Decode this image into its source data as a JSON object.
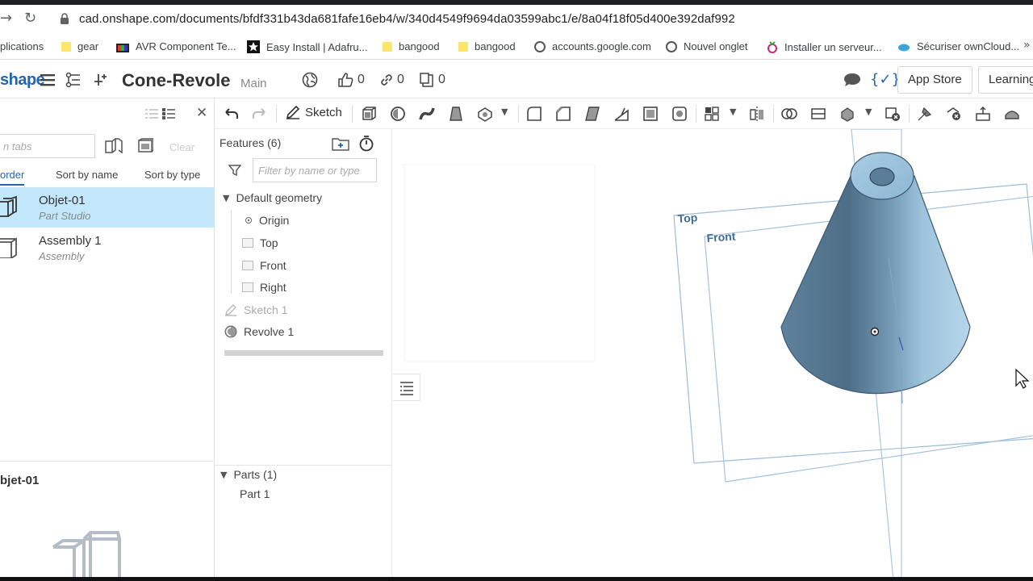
{
  "browser": {
    "url": "cad.onshape.com/documents/bfdf331b43da681fafe16eb4/w/340d4549f9694da03599abc1/e/8a04f18f05d400e392daf992",
    "bookmarks": [
      {
        "label": "plications",
        "icon": "apps-icon"
      },
      {
        "label": "gear",
        "icon": "folder-icon"
      },
      {
        "label": "AVR Component Te...",
        "icon": "site-icon"
      },
      {
        "label": "Easy Install | Adafru...",
        "icon": "star-icon"
      },
      {
        "label": "bangood",
        "icon": "folder-icon"
      },
      {
        "label": "bangood",
        "icon": "folder-icon"
      },
      {
        "label": "accounts.google.com",
        "icon": "globe-icon"
      },
      {
        "label": "Nouvel onglet",
        "icon": "globe-icon"
      },
      {
        "label": "Installer un serveur...",
        "icon": "site-icon"
      },
      {
        "label": "Sécuriser ownCloud...",
        "icon": "site-icon"
      }
    ]
  },
  "header": {
    "logo": "shape",
    "document_title": "Cone-Revole",
    "branch": "Main",
    "likes": "0",
    "links": "0",
    "copies": "0",
    "app_store": "App Store",
    "learning": "Learning"
  },
  "tabs_panel": {
    "search_placeholder": "n tabs",
    "clear": "Clear",
    "sort": {
      "order": "order",
      "by_name": "Sort by name",
      "by_type": "Sort by type"
    },
    "items": [
      {
        "name": "Objet-01",
        "type": "Part Studio"
      },
      {
        "name": "Assembly 1",
        "type": "Assembly"
      }
    ],
    "current_tab": "bjet-01"
  },
  "toolbar": {
    "sketch": "Sketch"
  },
  "features": {
    "title": "Features (6)",
    "filter_placeholder": "Filter by name or type",
    "default_geometry": "Default geometry",
    "origin": "Origin",
    "planes": [
      "Top",
      "Front",
      "Right"
    ],
    "sketch": "Sketch 1",
    "revolve": "Revolve 1",
    "parts_header": "Parts (1)",
    "parts": [
      "Part 1"
    ]
  },
  "viewport": {
    "plane_labels": {
      "top": "Top",
      "front": "Front"
    }
  },
  "colors": {
    "brand": "#1f66b3",
    "selected_row": "#c4e8fb",
    "cone_body": "#6f93ad"
  }
}
